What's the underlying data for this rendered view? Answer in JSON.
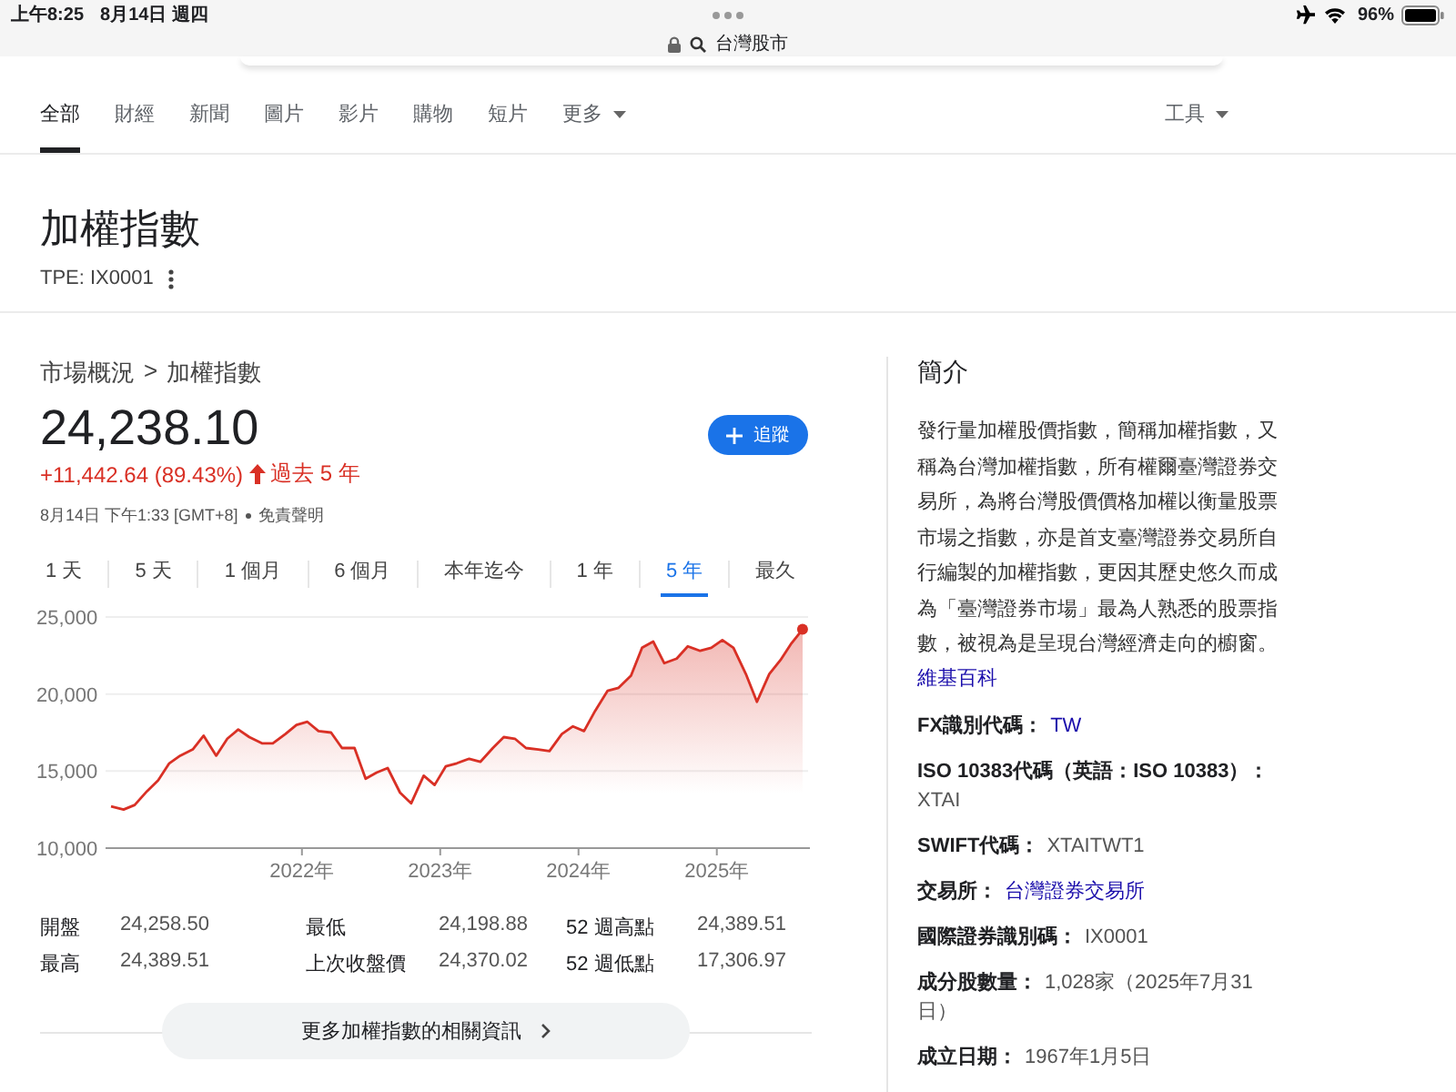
{
  "status_bar": {
    "time": "上午8:25",
    "date": "8月14日 週四",
    "address": "台灣股市",
    "battery": "96%"
  },
  "tabs": [
    {
      "label": "全部",
      "selected": true,
      "dropdown": false
    },
    {
      "label": "財經",
      "selected": false,
      "dropdown": false
    },
    {
      "label": "新聞",
      "selected": false,
      "dropdown": false
    },
    {
      "label": "圖片",
      "selected": false,
      "dropdown": false
    },
    {
      "label": "影片",
      "selected": false,
      "dropdown": false
    },
    {
      "label": "購物",
      "selected": false,
      "dropdown": false
    },
    {
      "label": "短片",
      "selected": false,
      "dropdown": false
    },
    {
      "label": "更多",
      "selected": false,
      "dropdown": true
    }
  ],
  "tools": "工具",
  "title": "加權指數",
  "ticker": "TPE: IX0001",
  "breadcrumb": [
    "市場概況",
    ">",
    "加權指數"
  ],
  "price": "24,238.10",
  "change": "+11,442.64 (89.43%)",
  "change_up": true,
  "period": "過去 5 年",
  "timestamp": "8月14日 下午1:33 [GMT+8]",
  "disclaimer": "免責聲明",
  "follow": "追蹤",
  "ranges": [
    {
      "label": "1 天",
      "selected": false
    },
    {
      "label": "5 天",
      "selected": false
    },
    {
      "label": "1 個月",
      "selected": false
    },
    {
      "label": "6 個月",
      "selected": false
    },
    {
      "label": "本年迄今",
      "selected": false
    },
    {
      "label": "1 年",
      "selected": false
    },
    {
      "label": "5 年",
      "selected": true
    },
    {
      "label": "最久",
      "selected": false
    }
  ],
  "chart_data": {
    "type": "area",
    "x": [
      2020.62,
      2020.71,
      2020.79,
      2020.88,
      2020.96,
      2021.04,
      2021.12,
      2021.21,
      2021.29,
      2021.38,
      2021.46,
      2021.54,
      2021.62,
      2021.71,
      2021.79,
      2021.88,
      2021.96,
      2022.04,
      2022.12,
      2022.21,
      2022.29,
      2022.38,
      2022.46,
      2022.54,
      2022.62,
      2022.71,
      2022.79,
      2022.88,
      2022.96,
      2023.04,
      2023.12,
      2023.21,
      2023.29,
      2023.38,
      2023.46,
      2023.54,
      2023.62,
      2023.71,
      2023.79,
      2023.88,
      2023.96,
      2024.04,
      2024.12,
      2024.21,
      2024.29,
      2024.38,
      2024.46,
      2024.54,
      2024.62,
      2024.71,
      2024.79,
      2024.88,
      2024.96,
      2025.04,
      2025.12,
      2025.21,
      2025.29,
      2025.38,
      2025.46,
      2025.54,
      2025.62
    ],
    "series": [
      {
        "color": "#d93025",
        "values": [
          12700,
          12500,
          12800,
          13700,
          14400,
          15500,
          16000,
          16400,
          17300,
          16000,
          17100,
          17700,
          17200,
          16800,
          16800,
          17400,
          18000,
          18200,
          17600,
          17500,
          16500,
          16500,
          14500,
          14900,
          15200,
          13600,
          12900,
          14700,
          14100,
          15300,
          15500,
          15800,
          15600,
          16500,
          17200,
          17100,
          16500,
          16400,
          16300,
          17400,
          17900,
          17600,
          18900,
          20200,
          20400,
          21200,
          23000,
          23400,
          22000,
          22300,
          23100,
          22800,
          23000,
          23500,
          23000,
          21300,
          19500,
          21300,
          22200,
          23300,
          24200
        ]
      }
    ],
    "xlim": [
      2020.58,
      2025.66
    ],
    "ylim": [
      10000,
      25000
    ],
    "xticks": [
      {
        "value": 2022,
        "label": "2022年"
      },
      {
        "value": 2023,
        "label": "2023年"
      },
      {
        "value": 2024,
        "label": "2024年"
      },
      {
        "value": 2025,
        "label": "2025年"
      }
    ],
    "yticks": [
      {
        "value": 10000,
        "label": "10,000"
      },
      {
        "value": 15000,
        "label": "15,000"
      },
      {
        "value": 20000,
        "label": "20,000"
      },
      {
        "value": 25000,
        "label": "25,000"
      }
    ]
  },
  "stats": [
    [
      {
        "label": "開盤",
        "value": "24,258.50"
      },
      {
        "label": "最低",
        "value": "24,198.88"
      },
      {
        "label": "52 週高點",
        "value": "24,389.51"
      }
    ],
    [
      {
        "label": "最高",
        "value": "24,389.51"
      },
      {
        "label": "上次收盤價",
        "value": "24,370.02"
      },
      {
        "label": "52 週低點",
        "value": "17,306.97"
      }
    ]
  ],
  "more_button": "更多加權指數的相關資訊",
  "about": {
    "heading": "簡介",
    "text": "發行量加權股價指數，簡稱加權指數，又稱為台灣加權指數，所有權爾臺灣證券交易所，為將台灣股價價格加權以衡量股票市場之指數，亦是首支臺灣證券交易所自行編製的加權指數，更因其歷史悠久而成為「臺灣證券市場」最為人熟悉的股票指數，被視為是呈現台灣經濟走向的櫥窗。",
    "source": "維基百科"
  },
  "facts": [
    {
      "label": "FX識別代碼：",
      "value": "TW",
      "kind": "link"
    },
    {
      "label": "ISO 10383代碼（英語：ISO 10383）：",
      "value": "XTAI",
      "kind": "text"
    },
    {
      "label": "SWIFT代碼：",
      "value": "XTAITWT1",
      "kind": "text"
    },
    {
      "label": "交易所：",
      "value": "台灣證券交易所",
      "kind": "link"
    },
    {
      "label": "國際證券識別碼：",
      "value": "IX0001",
      "kind": "text"
    },
    {
      "label": "成分股數量：",
      "value": "1,028家（2025年7月31日）",
      "kind": "text"
    },
    {
      "label": "成立日期：",
      "value": "1967年1月5日",
      "kind": "text"
    }
  ]
}
